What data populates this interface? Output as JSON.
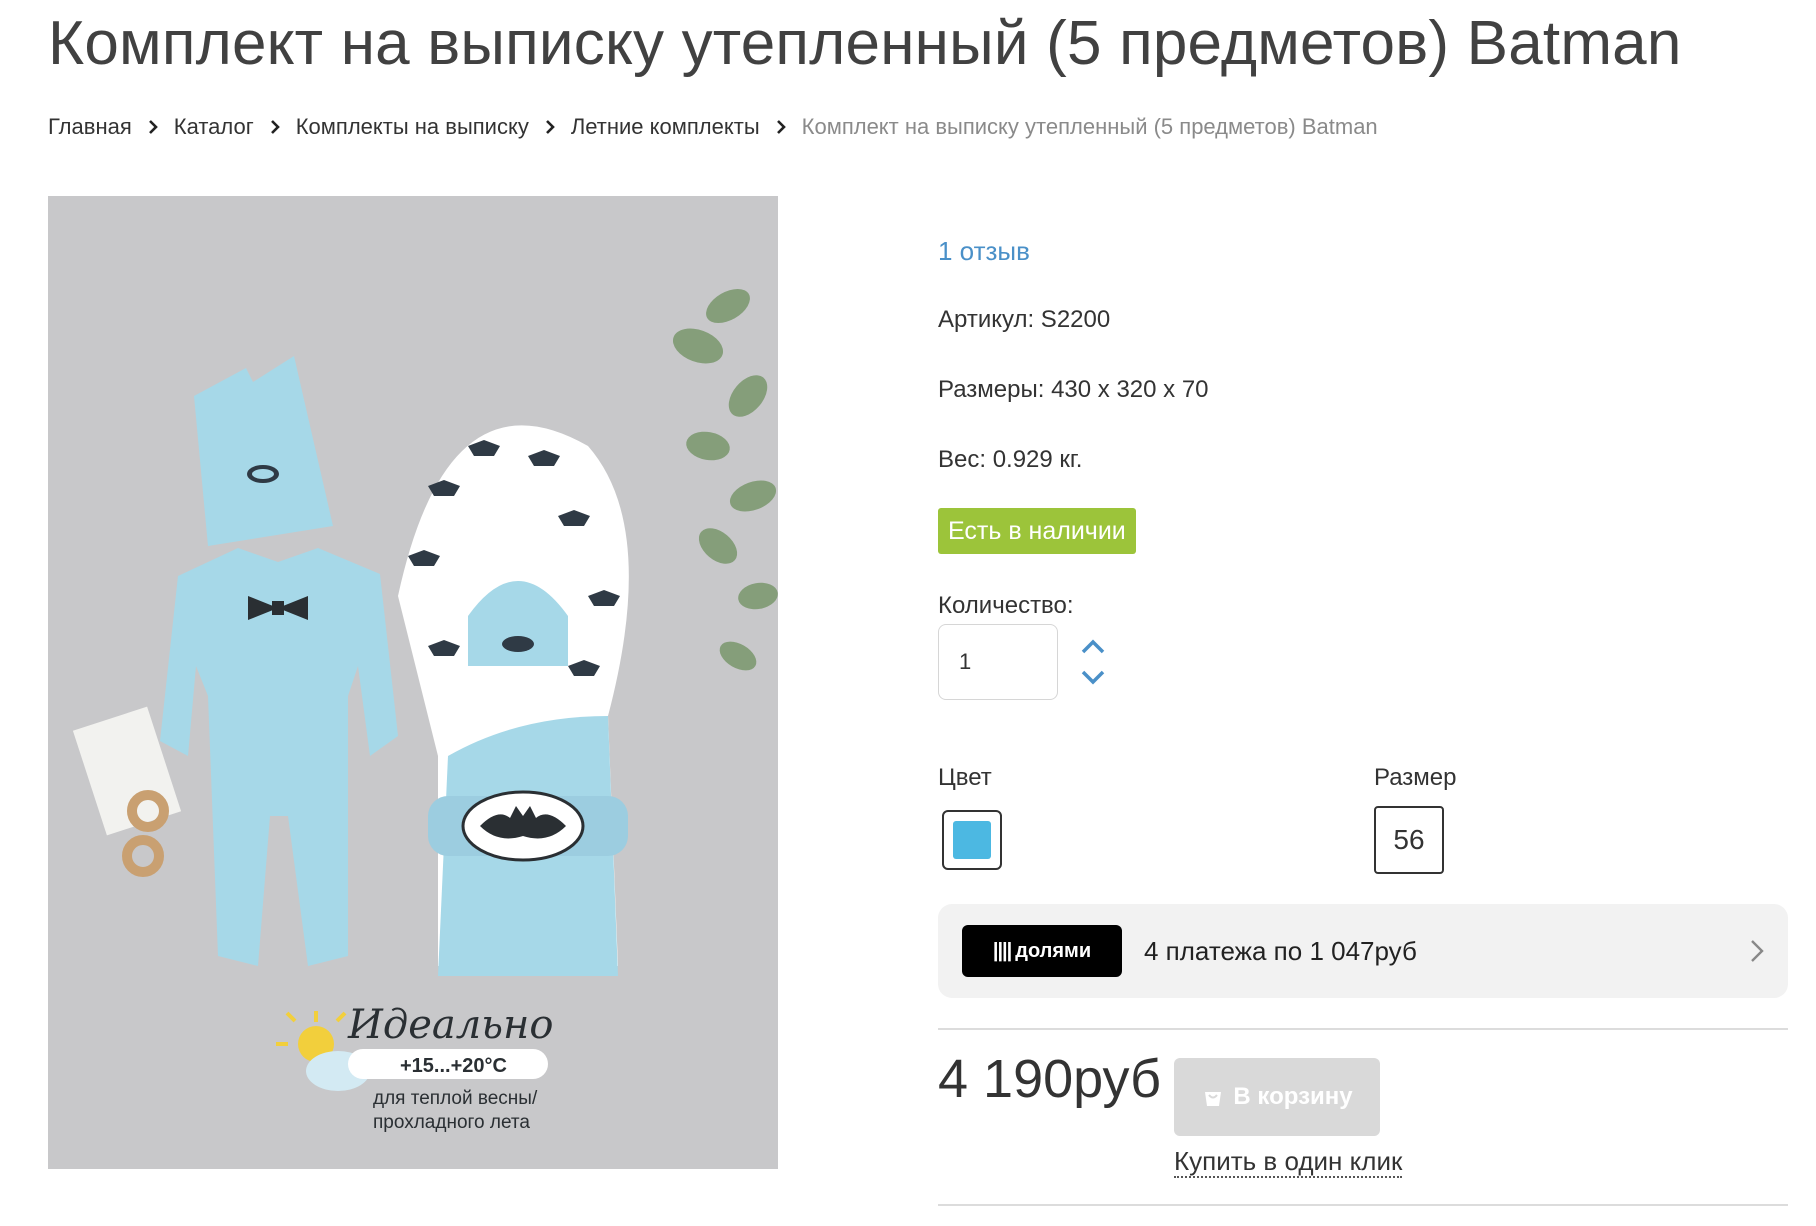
{
  "product": {
    "title": "Комплект на выписку утепленный (5 предметов) Batman",
    "reviews": "1 отзыв",
    "article": "Артикул: S2200",
    "dimensions": "Размеры: 430 х 320 х 70",
    "weight": "Вес: 0.929 кг.",
    "stock": "Есть в наличии",
    "quantity_label": "Количество:",
    "quantity_value": "1",
    "color_label": "Цвет",
    "size_label": "Размер",
    "size_value": "56",
    "swatch_color": "#4cb8e2",
    "price": "4 190руб",
    "cart_button": "В корзину",
    "one_click": "Купить в один клик"
  },
  "breadcrumb": [
    {
      "label": "Главная"
    },
    {
      "label": "Каталог"
    },
    {
      "label": "Комплекты на выписку"
    },
    {
      "label": "Летние комплекты"
    },
    {
      "label": "Комплект на выписку утепленный (5 предметов) Batman"
    }
  ],
  "dolyami": {
    "brand": "долями",
    "text": "4 платежа по 1 047руб"
  },
  "photo_caption": {
    "headline": "Идеально",
    "temp": "+15...+20°C",
    "line1": "для теплой весны/",
    "line2": "прохладного лета"
  },
  "colors": {
    "accent_link": "#4a90c8",
    "stock_green": "#9cc43a",
    "garment_blue": "#a6d8e8"
  },
  "icons": [
    "chevron-right-icon",
    "chevron-up-icon",
    "chevron-down-icon",
    "cart-icon"
  ]
}
